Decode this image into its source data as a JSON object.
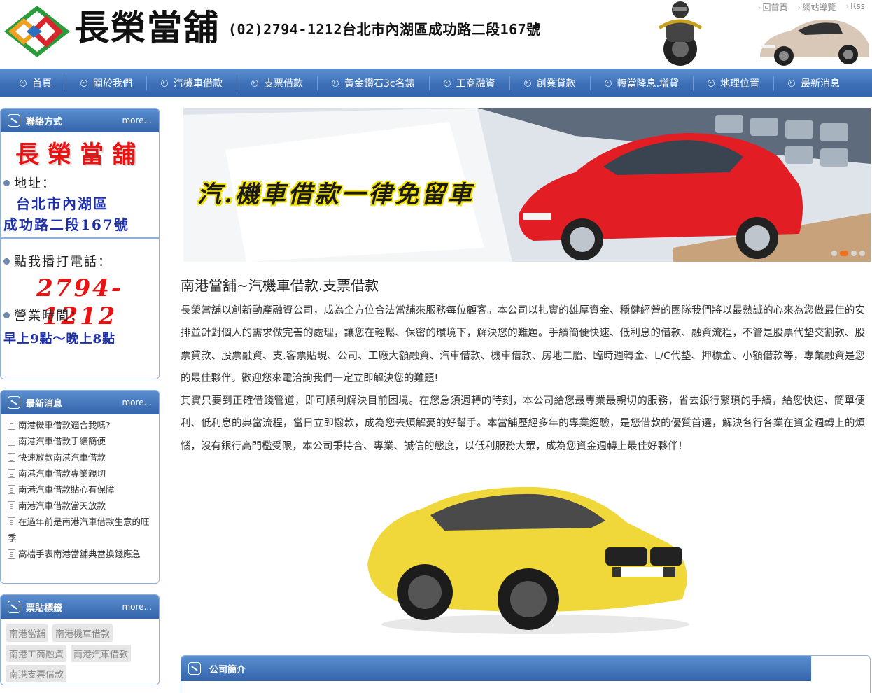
{
  "header": {
    "brand": "長榮當舖",
    "contact_line": "(02)2794-1212台北市內湖區成功路二段167號",
    "top_links": [
      "回首頁",
      "網站導覽",
      "Rss"
    ]
  },
  "nav": {
    "items": [
      "首頁",
      "關於我們",
      "汽機車借款",
      "支票借款",
      "黃金鑽石3c名錶",
      "工商融資",
      "創業貸款",
      "轉當降息.增貸",
      "地理位置",
      "最新消息"
    ]
  },
  "contact_box": {
    "title": "聯絡方式",
    "more": "more...",
    "name": "長榮當舖",
    "address_label": "地址：",
    "address_line1": "台北市內湖區",
    "address_line2": "成功路二段167號",
    "phone_label": "點我播打電話：",
    "phone": "2794-1212",
    "hours_label": "營業時間：",
    "hours": "早上9點～晚上8點"
  },
  "news_box": {
    "title": "最新消息",
    "more": "more...",
    "items": [
      "南港機車借款適合我嗎?",
      "南港汽車借款手續簡便",
      "快速放款南港汽車借款",
      "南港汽車借款專業親切",
      "南港汽車借款貼心有保障",
      "南港汽車借款當天放款",
      "在過年前是南港汽車借款生意的旺季",
      "高檔手表南港當舖典當換錢應急"
    ]
  },
  "tags_box": {
    "title": "票貼標籤",
    "more": "more...",
    "tags": [
      "南港當舖",
      "南港機車借款",
      "南港工商融資",
      "南港汽車借款",
      "南港支票借款"
    ]
  },
  "banner": {
    "text": "汽.機車借款一律免留車",
    "slide_count": 4,
    "active_slide": 2
  },
  "main": {
    "title": "南港當舖~汽機車借款.支票借款",
    "paragraph1": "長榮當舖以創新動產融資公司，成為全方位合法當舖來服務每位顧客。本公司以扎實的雄厚資金、穩健經營的團隊我們將以最熱誠的心來為您做最佳的安排並針對個人的需求做完善的處理，讓您在輕鬆、保密的環境下，解決您的難題。手續簡便快速、低利息的借款、融資流程，不管是股票代墊交割款、股票貸款、股票融資、支.客票貼現、公司、工廠大額融資、汽車借款、機車借款、房地二胎、臨時週轉金、L/C代墊、押標金、小額借款等，專業融資是您的最佳夥伴。歡迎您來電洽詢我們一定立即解決您的難題!",
    "paragraph2": "其實只要到正確借錢管道，即可順利解決目前困境。在您急須週轉的時刻，本公司給您最專業最親切的服務，省去銀行繁瑣的手續，給您快速、簡單便利、低利息的典當流程，當日立即撥款，成為您去煩解憂的好幫手。本當舖歷經多年的專業經驗，是您借款的優質首選，解決各行各業在資金週轉上的煩惱，沒有銀行高門檻受限，本公司秉持合、專業、誠信的態度，以低利服務大眾，成為您資金週轉上最佳好夥伴！"
  },
  "profile_box": {
    "title": "公司簡介"
  },
  "colors": {
    "nav_blue": "#3d6fb7",
    "accent_red": "#e11111",
    "text_blue": "#1d2fa8"
  }
}
